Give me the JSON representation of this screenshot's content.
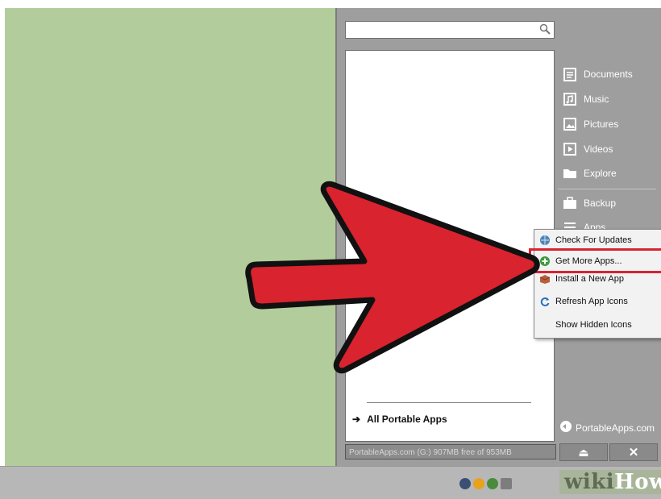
{
  "search": {
    "placeholder": ""
  },
  "side_menu": {
    "items": [
      {
        "label": "Documents",
        "icon": "documents-icon"
      },
      {
        "label": "Music",
        "icon": "music-icon"
      },
      {
        "label": "Pictures",
        "icon": "pictures-icon"
      },
      {
        "label": "Videos",
        "icon": "videos-icon"
      },
      {
        "label": "Explore",
        "icon": "folder-icon"
      }
    ],
    "backup": {
      "label": "Backup",
      "icon": "briefcase-icon"
    },
    "apps": {
      "label": "Apps",
      "icon": "apps-list-icon"
    }
  },
  "app_list": {
    "all_apps_label": "All Portable Apps"
  },
  "status_bar": {
    "text": "PortableApps.com (G:) 907MB free of 953MB"
  },
  "brand": {
    "label": "PortableApps.com"
  },
  "buttons": {
    "eject_symbol": "⏏",
    "close_symbol": "✕"
  },
  "context_menu": {
    "items": [
      {
        "label": "Check For Updates",
        "icon": "globe-update-icon"
      },
      {
        "label": "Get More Apps...",
        "icon": "add-green-icon",
        "highlighted": true
      },
      {
        "label": "Install a New App",
        "icon": "install-box-icon"
      },
      {
        "label": "Refresh App Icons",
        "icon": "refresh-icon"
      },
      {
        "label": "Show Hidden Icons",
        "icon": ""
      }
    ]
  },
  "watermark": {
    "prefix": "wiki",
    "suffix": "How"
  },
  "colors": {
    "highlight": "#d9232f",
    "arrow": "#d9232f",
    "desktop": "#b3cc9c"
  }
}
